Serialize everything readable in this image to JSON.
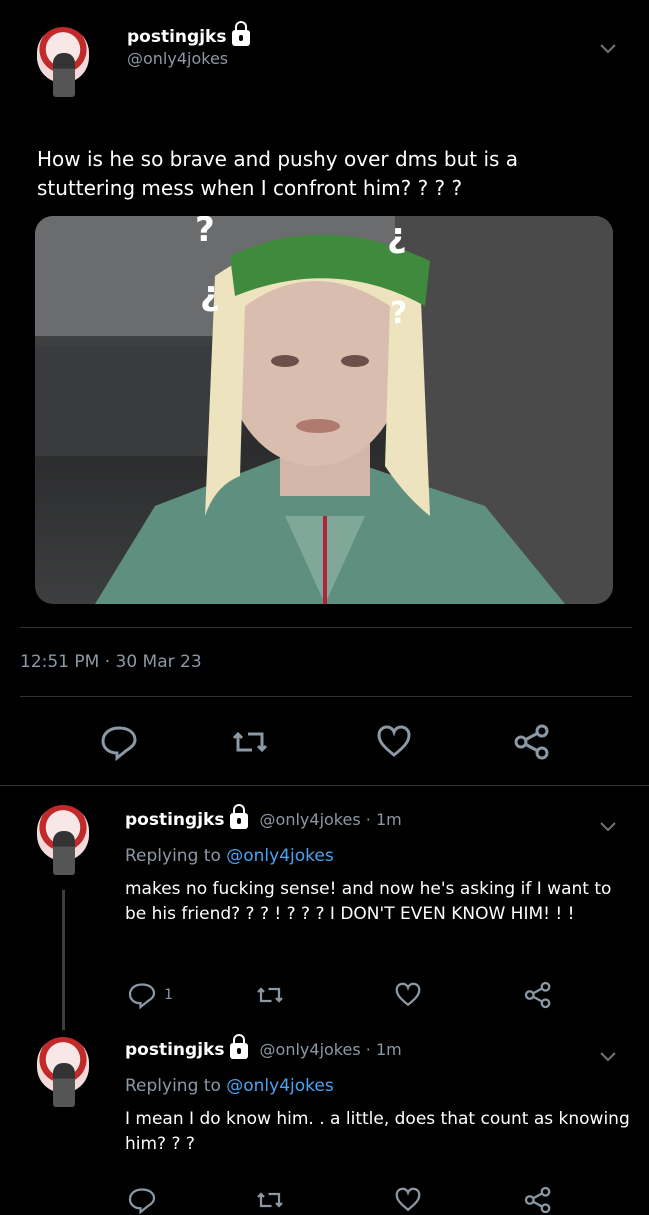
{
  "main_tweet": {
    "display_name": "postingjks",
    "handle": "@only4jokes",
    "text": "How is he so brave and pushy over dms but is a stuttering mess when I confront him? ? ? ?",
    "timestamp": "12:51 PM · 30 Mar 23",
    "image_overlay_marks": [
      "?",
      "¿",
      "¿",
      "?"
    ]
  },
  "replies": [
    {
      "display_name": "postingjks",
      "handle": "@only4jokes",
      "time": "· 1m",
      "replying_prefix": "Replying to",
      "replying_handle": "@only4jokes",
      "text": "makes no fucking sense!  and now he's asking if I want to be his friend? ? ? ! ? ? ?  I DON'T EVEN KNOW HIM! ! !",
      "reply_count": "1"
    },
    {
      "display_name": "postingjks",
      "handle": "@only4jokes",
      "time": "· 1m",
      "replying_prefix": "Replying to",
      "replying_handle": "@only4jokes",
      "text": "I mean I do know him. . a little,  does that count as knowing him? ? ?",
      "reply_count": ""
    }
  ],
  "icons": [
    "reply-icon",
    "retweet-icon",
    "like-icon",
    "share-icon",
    "lock-icon",
    "chevron-down-icon"
  ],
  "colors": {
    "background": "#000000",
    "secondary_text": "#8b98a5",
    "link": "#4aa3f2",
    "divider": "#2f3336"
  }
}
